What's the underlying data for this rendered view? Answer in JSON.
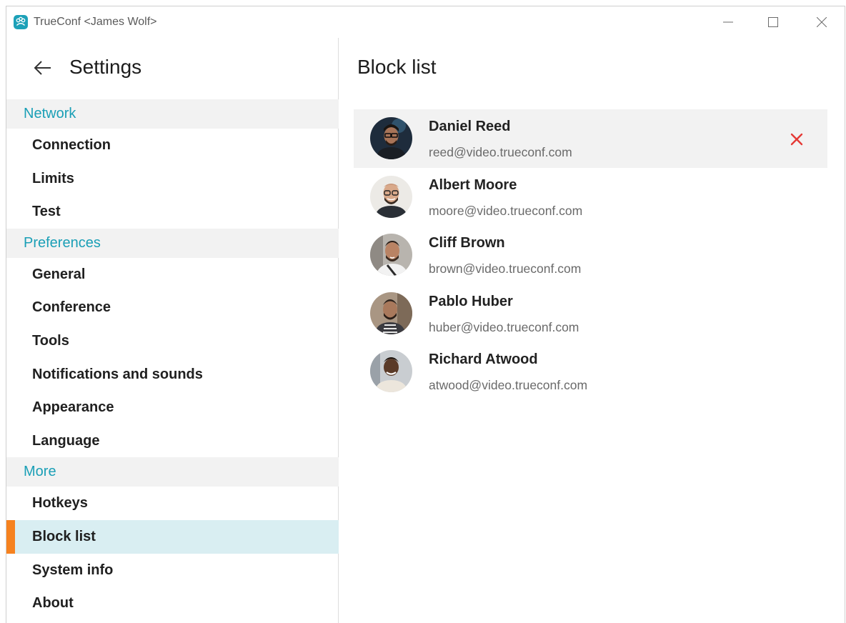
{
  "window": {
    "title": "TrueConf <James Wolf>"
  },
  "settings": {
    "title": "Settings"
  },
  "nav": {
    "sections": [
      {
        "header": "Network",
        "items": [
          "Connection",
          "Limits",
          "Test"
        ]
      },
      {
        "header": "Preferences",
        "items": [
          "General",
          "Conference",
          "Tools",
          "Notifications and sounds",
          "Appearance",
          "Language"
        ]
      },
      {
        "header": "More",
        "items": [
          "Hotkeys",
          "Block list",
          "System info",
          "About"
        ]
      }
    ],
    "active_item": "Block list"
  },
  "main": {
    "title": "Block list",
    "contacts": [
      {
        "name": "Daniel Reed",
        "email": "reed@video.trueconf.com"
      },
      {
        "name": "Albert Moore",
        "email": "moore@video.trueconf.com"
      },
      {
        "name": "Cliff Brown",
        "email": "brown@video.trueconf.com"
      },
      {
        "name": "Pablo Huber",
        "email": "huber@video.trueconf.com"
      },
      {
        "name": "Richard Atwood",
        "email": "atwood@video.trueconf.com"
      }
    ]
  },
  "icons": {
    "app": "trueconf-logo-icon",
    "back": "arrow-left-icon",
    "remove": "close-x-icon",
    "minimize": "minimize-icon",
    "maximize": "maximize-icon",
    "close": "close-icon"
  },
  "colors": {
    "accent": "#1a9fb6",
    "active_marker": "#f6821f",
    "active_bg": "#d9eef2",
    "remove": "#e53935"
  }
}
